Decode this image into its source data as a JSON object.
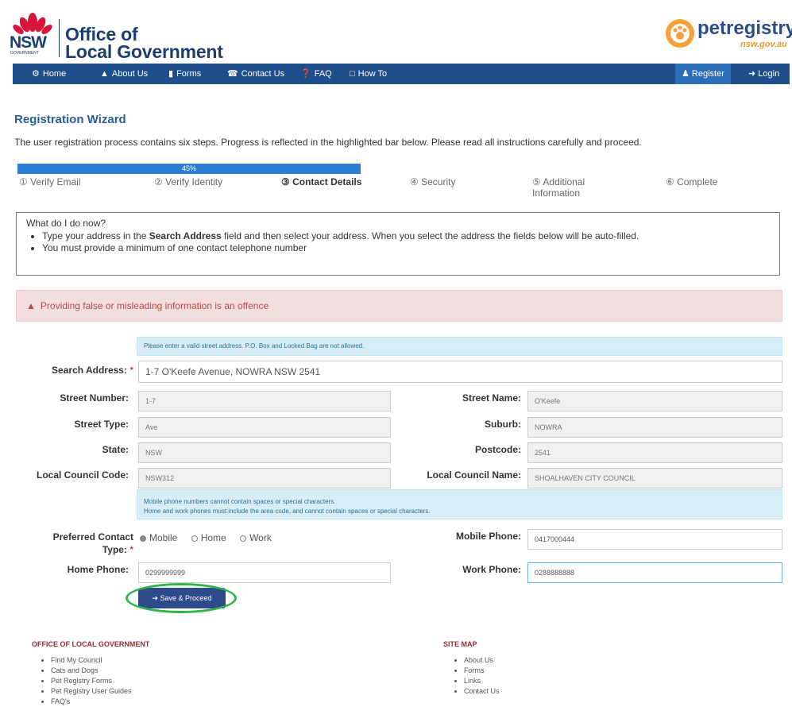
{
  "header": {
    "logo_text": "NSW",
    "logo_sub": "GOVERNMENT",
    "org_line1": "Office of",
    "org_line2": "Local Government",
    "brand": "petregistry",
    "brand_sub": "nsw.gov.au"
  },
  "nav": {
    "items": [
      {
        "label": "Home",
        "icon": "home-icon"
      },
      {
        "label": "About Us",
        "icon": "bank-icon"
      },
      {
        "label": "Forms",
        "icon": "document-icon"
      },
      {
        "label": "Contact Us",
        "icon": "phone-icon"
      },
      {
        "label": "FAQ",
        "icon": "info-icon"
      },
      {
        "label": "How To",
        "icon": "speech-bubble-icon"
      }
    ],
    "register": "Register",
    "login": "Login"
  },
  "wizard": {
    "title": "Registration Wizard",
    "intro": "The user registration process contains six steps. Progress is reflected in the highlighted bar below. Please read all instructions carefully and proceed.",
    "progress_label": "45%",
    "progress_fraction": 0.45,
    "steps": [
      {
        "label": "① Verify Email"
      },
      {
        "label": "② Verify Identity"
      },
      {
        "label": "③ Contact Details"
      },
      {
        "label": "④ Security"
      },
      {
        "label": "⑤ Additional Information"
      },
      {
        "label": "⑥ Complete"
      }
    ]
  },
  "help": {
    "question": "What do I do now?",
    "line1_pre": "Type your address in the ",
    "line1_bold": "Search Address",
    "line1_post": " field and then select your address. When you select the address the fields below will be auto-filled.",
    "line2": "You must provide a minimum of one contact telephone number"
  },
  "warning": "Providing false or misleading information is an offence",
  "form": {
    "address_note": "Please enter a valid street address. P.O. Box and Locked Bag are not allowed.",
    "search_label": "Search Address:",
    "search_value": "1-7 O'Keefe Avenue, NOWRA  NSW  2541",
    "street_number_label": "Street Number:",
    "street_number": "1-7",
    "street_name_label": "Street Name:",
    "street_name": "O'Keefe",
    "street_type_label": "Street Type:",
    "street_type": "Ave",
    "suburb_label": "Suburb:",
    "suburb": "NOWRA",
    "state_label": "State:",
    "state": "NSW",
    "postcode_label": "Postcode:",
    "postcode": "2541",
    "council_code_label": "Local Council Code:",
    "council_code": "NSW312",
    "council_name_label": "Local Council Name:",
    "council_name": "SHOALHAVEN CITY COUNCIL",
    "phone_note1": "Mobile phone numbers cannot contain spaces or special characters.",
    "phone_note2": "Home and work phones must include the area code, and cannot contain spaces or special characters.",
    "contact_type_label_1": "Preferred Contact",
    "contact_type_label_2": "Type:",
    "contact_options": [
      "Mobile",
      "Home",
      "Work"
    ],
    "contact_selected": "Mobile",
    "mobile_label": "Mobile Phone:",
    "mobile": "0417000444",
    "home_label": "Home Phone:",
    "home": "0299999999",
    "work_label": "Work Phone:",
    "work": "0288888888",
    "save_label": "Save & Proceed"
  },
  "footer": {
    "left_title": "OFFICE OF LOCAL GOVERNMENT",
    "left_links": [
      "Find My Council",
      "Cats and Dogs",
      "Pet Registry Forms",
      "Pet Registry User Guides",
      "FAQ's"
    ],
    "right_title": "SITE MAP",
    "right_links": [
      "About Us",
      "Forms",
      "Links",
      "Contact Us"
    ]
  },
  "colors": {
    "nav_bg": "#1f4e8c",
    "title": "#2a5c9a",
    "progress": "#2a7fd4",
    "warning_bg": "#f2dede",
    "note_bg": "#d9edf7",
    "highlight_ring": "#2fb34a"
  }
}
